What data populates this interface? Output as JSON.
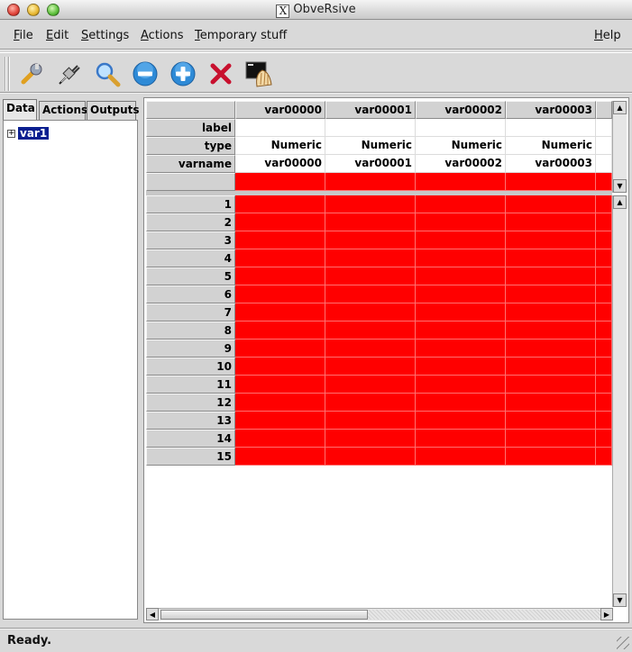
{
  "window": {
    "title": "ObveRsive"
  },
  "menu": {
    "file": {
      "u": "F",
      "rest": "ile"
    },
    "edit": {
      "u": "E",
      "rest": "dit"
    },
    "settings": {
      "u": "S",
      "rest": "ettings"
    },
    "actions": {
      "u": "A",
      "rest": "ctions"
    },
    "temporary": {
      "u": "T",
      "rest": "emporary stuff"
    },
    "help": {
      "u": "H",
      "rest": "elp"
    }
  },
  "toolbar": {
    "icons": [
      "wrench-icon",
      "plug-icon",
      "magnifier-icon",
      "minus-circle-icon",
      "plus-circle-icon",
      "close-x-icon",
      "terminal-shell-icon"
    ]
  },
  "left_panel": {
    "tabs": [
      "Data",
      "Actions",
      "Outputs"
    ],
    "active_tab": "Data",
    "tree": [
      {
        "label": "var1",
        "expander": "+"
      }
    ]
  },
  "grid": {
    "columns": [
      "var00000",
      "var00001",
      "var00002",
      "var00003"
    ],
    "meta_rows": [
      {
        "header": "label",
        "values": [
          "",
          "",
          "",
          ""
        ]
      },
      {
        "header": "type",
        "values": [
          "Numeric",
          "Numeric",
          "Numeric",
          "Numeric"
        ]
      },
      {
        "header": "varname",
        "values": [
          "var00000",
          "var00001",
          "var00002",
          "var00003"
        ]
      }
    ],
    "data_row_headers": [
      "1",
      "2",
      "3",
      "4",
      "5",
      "6",
      "7",
      "8",
      "9",
      "10",
      "11",
      "12",
      "13",
      "14",
      "15"
    ],
    "missing_color": "#ff0000"
  },
  "status": {
    "text": "Ready."
  }
}
